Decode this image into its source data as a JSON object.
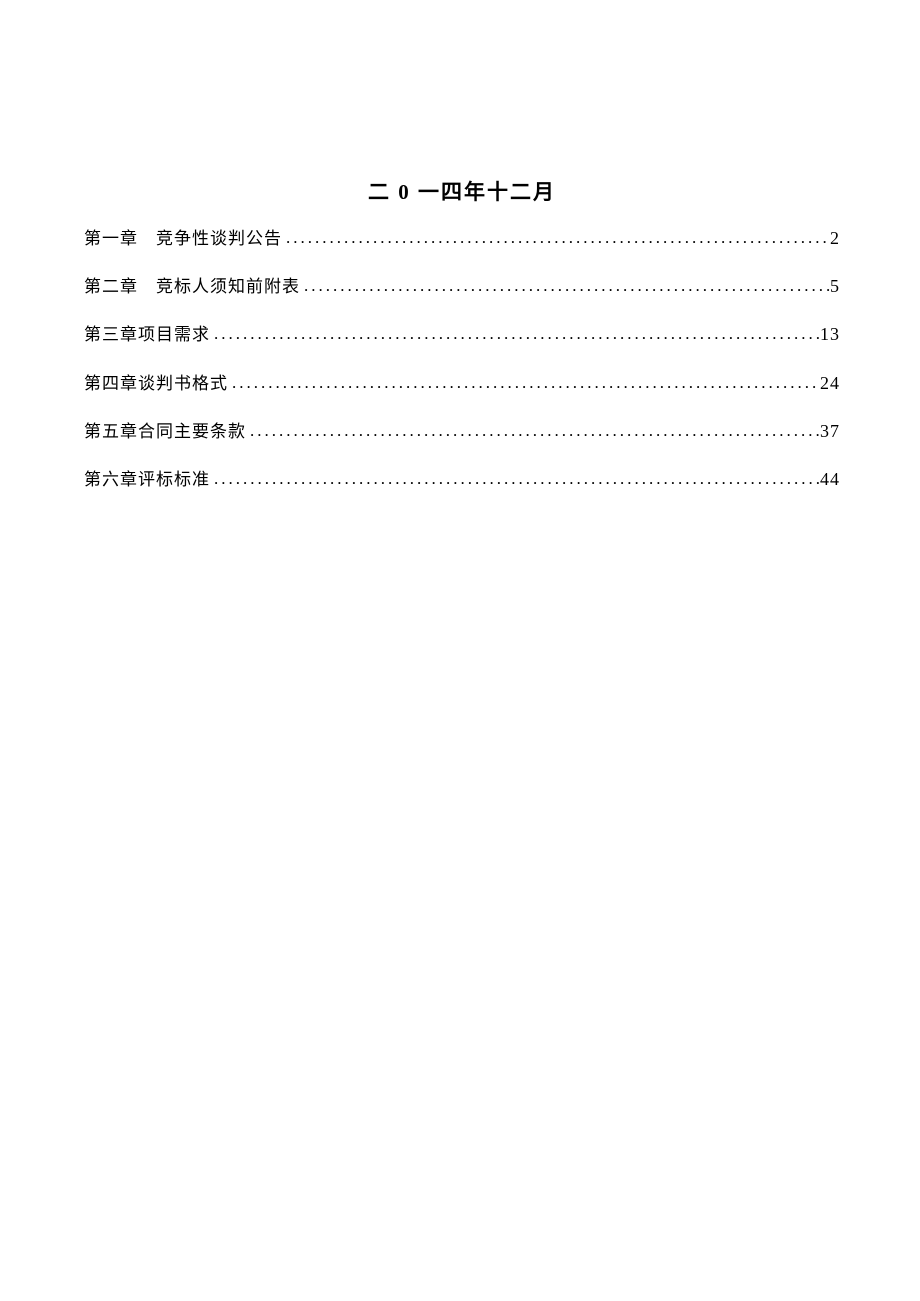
{
  "title": "二 0 一四年十二月",
  "toc": [
    {
      "label": "第一章　竞争性谈判公告 ",
      "page": "2"
    },
    {
      "label": "第二章　竞标人须知前附表 ",
      "page": "5"
    },
    {
      "label": "第三章项目需求",
      "page": "13"
    },
    {
      "label": "第四章谈判书格式",
      "page": "24"
    },
    {
      "label": "第五章合同主要条款",
      "page": "37"
    },
    {
      "label": "第六章评标标准",
      "page": "44"
    }
  ],
  "dots": "............................................................................................................"
}
